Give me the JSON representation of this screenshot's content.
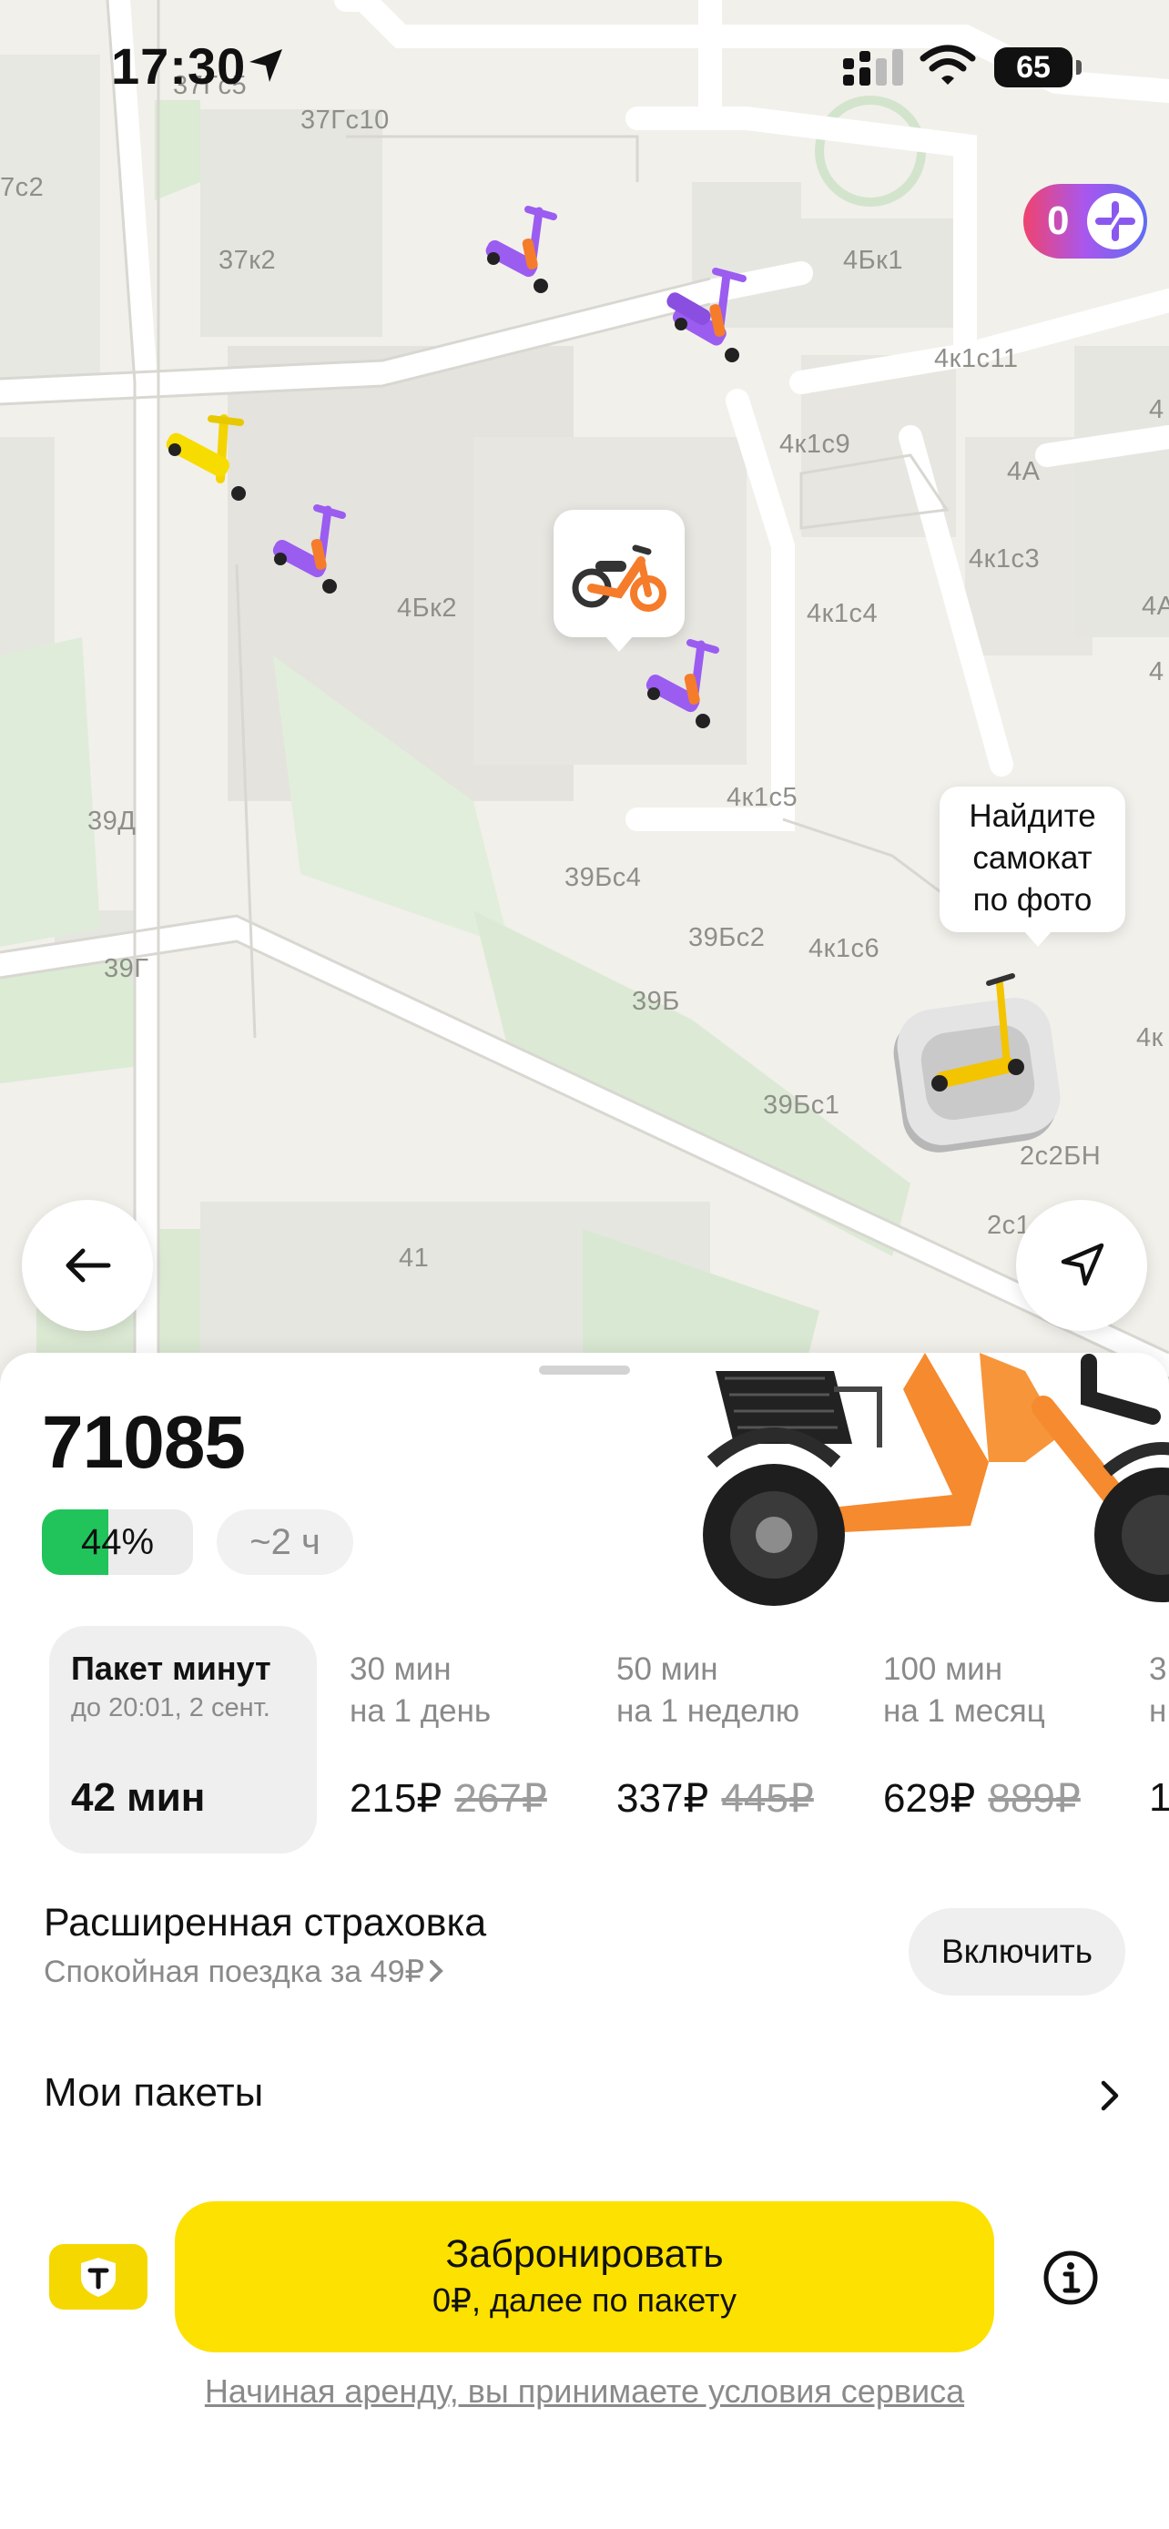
{
  "status_bar": {
    "time": "17:30",
    "battery": "65"
  },
  "map": {
    "labels": [
      {
        "id": "l1",
        "text": "37Гс5"
      },
      {
        "id": "l2",
        "text": "37Гс10"
      },
      {
        "id": "l3",
        "text": "7с2"
      },
      {
        "id": "l4",
        "text": "37к2"
      },
      {
        "id": "l5",
        "text": "4Бк1"
      },
      {
        "id": "l6",
        "text": "4к1с11"
      },
      {
        "id": "l7",
        "text": "4к1с9"
      },
      {
        "id": "l8",
        "text": "4А"
      },
      {
        "id": "l9",
        "text": "4к1с3"
      },
      {
        "id": "l10",
        "text": "4А"
      },
      {
        "id": "l11",
        "text": "4Бк2"
      },
      {
        "id": "l12",
        "text": "4к1с4"
      },
      {
        "id": "l13",
        "text": "4"
      },
      {
        "id": "l14",
        "text": "4к1с5"
      },
      {
        "id": "l15",
        "text": "39Д"
      },
      {
        "id": "l16",
        "text": "39Бс4"
      },
      {
        "id": "l17",
        "text": "39Бс2"
      },
      {
        "id": "l18",
        "text": "4к1с6"
      },
      {
        "id": "l19",
        "text": "39Г"
      },
      {
        "id": "l20",
        "text": "39Б"
      },
      {
        "id": "l21",
        "text": "4к"
      },
      {
        "id": "l22",
        "text": "39Бс1"
      },
      {
        "id": "l23",
        "text": "2с2БН"
      },
      {
        "id": "l24",
        "text": "2с1"
      },
      {
        "id": "l25",
        "text": "41"
      },
      {
        "id": "l26",
        "text": "4"
      }
    ],
    "plus_badge": {
      "count": "0"
    },
    "photo_callout": {
      "line1": "Найдите",
      "line2": "самокат",
      "line3": "по фото"
    }
  },
  "vehicle": {
    "id": "71085",
    "battery": "44%",
    "battery_level": 0.44,
    "range": "~2 ч"
  },
  "tariffs": {
    "selected": {
      "title": "Пакет минут",
      "subtitle": "до 20:01, 2 сент.",
      "amount": "42 мин"
    },
    "options": [
      {
        "duration": "30 мин",
        "period": "на 1 день",
        "price": "215₽",
        "old_price": "267₽"
      },
      {
        "duration": "50 мин",
        "period": "на 1 неделю",
        "price": "337₽",
        "old_price": "445₽"
      },
      {
        "duration": "100 мин",
        "period": "на 1 месяц",
        "price": "629₽",
        "old_price": "889₽"
      },
      {
        "duration": "3",
        "period": "н",
        "price": "1",
        "old_price": ""
      }
    ]
  },
  "insurance": {
    "title": "Расширенная страховка",
    "subtitle": "Спокойная поездка за 49₽",
    "button": "Включить"
  },
  "packages": {
    "label": "Мои пакеты"
  },
  "booking": {
    "button_label": "Забронировать",
    "button_sub": "0₽, далее по пакету",
    "terms": "Начиная аренду, вы принимаете условия сервиса"
  },
  "colors": {
    "accent_yellow": "#fde100",
    "battery_green": "#21c45b",
    "scooter_purple": "#9b5cf0",
    "scooter_orange": "#f57c2a"
  }
}
